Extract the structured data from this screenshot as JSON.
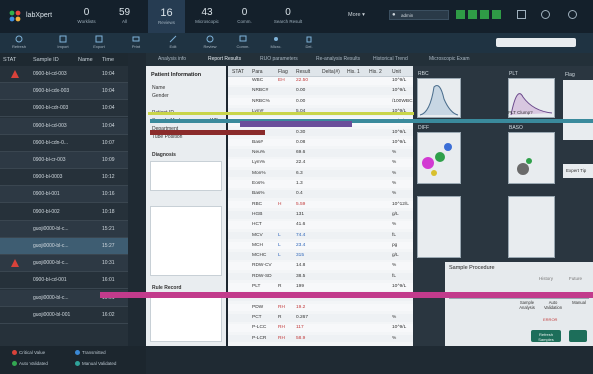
{
  "app": {
    "name": "labXpert"
  },
  "header": {
    "stats": [
      {
        "value": "0",
        "label": "Worklists"
      },
      {
        "value": "59",
        "label": "All"
      },
      {
        "value": "16",
        "label": "Reviews"
      },
      {
        "value": "43",
        "label": "Microscopic"
      },
      {
        "value": "0",
        "label": "Comm."
      },
      {
        "value": "0",
        "label": "Search Result"
      }
    ],
    "more_label": "More",
    "user_label": "admin"
  },
  "toolbar": {
    "items": [
      "Refresh",
      "Import",
      "Export",
      "Print",
      "Edit",
      "Review",
      "Comm.",
      "Micro.",
      "Del."
    ]
  },
  "sample_list": {
    "columns": [
      "STAT",
      "Sample ID",
      "Name",
      "Time"
    ],
    "rows": [
      {
        "sample_id": "0900-bl-cd-003",
        "time": "10:04",
        "alert": true
      },
      {
        "sample_id": "0900-bl-cdx-003",
        "time": "10:04",
        "alert": false
      },
      {
        "sample_id": "0900-bl-cdr-003",
        "time": "10:04",
        "alert": false
      },
      {
        "sample_id": "0900-bl-cd-003",
        "time": "10:04",
        "alert": false
      },
      {
        "sample_id": "0900-bl-cdn-0...",
        "time": "10:07",
        "alert": false
      },
      {
        "sample_id": "0900-bl-cr-003",
        "time": "10:09",
        "alert": false
      },
      {
        "sample_id": "0900-bl-0003",
        "time": "10:12",
        "alert": false
      },
      {
        "sample_id": "0900-bl-001",
        "time": "10:16",
        "alert": false
      },
      {
        "sample_id": "0900-bl-002",
        "time": "10:18",
        "alert": false
      },
      {
        "sample_id": "guoji0000-bl-c...",
        "time": "15:21",
        "alert": false
      },
      {
        "sample_id": "guoji0000-bl-c...",
        "time": "15:27",
        "alert": false
      },
      {
        "sample_id": "guoji0000-bl-c...",
        "time": "10:31",
        "alert": true
      },
      {
        "sample_id": "0900-bl-cd-001",
        "time": "16:01",
        "alert": false
      },
      {
        "sample_id": "guoji0000-bl-c...",
        "time": "10:01",
        "alert": false
      },
      {
        "sample_id": "guoji0000-bl-001",
        "time": "16:02",
        "alert": false
      }
    ]
  },
  "legend": {
    "critical": "Critical Value",
    "auto_validated": "Auto Validated",
    "transmitted": "Transmitted",
    "manual_validated": "Manual Validated"
  },
  "tabs": [
    "Analysis info",
    "Report Results",
    "RUO parameters",
    "Re-analysis Results",
    "Historical Trend",
    "Microscopic Exam"
  ],
  "patient_info": {
    "title": "Patient Information",
    "fields": [
      "Name",
      "Gender",
      "Patient ID",
      "Sample Mode",
      "Department",
      "Tube Position"
    ],
    "sample_mode_value": "WB",
    "diagnosis_label": "Diagnosis",
    "rule_record_label": "Rule Record"
  },
  "results": {
    "columns": [
      "STAT",
      "Para",
      "Flag",
      "Result",
      "Delta(#)",
      "His. 1",
      "His. 2",
      "Unit"
    ],
    "rows": [
      {
        "para": "WBC",
        "flag": "EH",
        "result": "22.50",
        "unit": "10^9/L"
      },
      {
        "para": "NRBC#",
        "flag": "",
        "result": "0.00",
        "unit": "10^9/L"
      },
      {
        "para": "NRBC%",
        "flag": "",
        "result": "0.00",
        "unit": "/100WBC"
      },
      {
        "para": "Lym#",
        "flag": "",
        "result": "5.04",
        "unit": "10^9/L"
      },
      {
        "para": "Mon#",
        "flag": "",
        "result": "1.06",
        "unit": "10^9/L"
      },
      {
        "para": "Eos#",
        "flag": "",
        "result": "0.30",
        "unit": "10^9/L"
      },
      {
        "para": "Bas#",
        "flag": "",
        "result": "0.08",
        "unit": "10^9/L"
      },
      {
        "para": "Neu%",
        "flag": "",
        "result": "69.6",
        "unit": "%"
      },
      {
        "para": "Lym%",
        "flag": "",
        "result": "22.4",
        "unit": "%"
      },
      {
        "para": "Mon%",
        "flag": "",
        "result": "6.3",
        "unit": "%"
      },
      {
        "para": "Eos%",
        "flag": "",
        "result": "1.3",
        "unit": "%"
      },
      {
        "para": "Bas%",
        "flag": "",
        "result": "0.4",
        "unit": "%"
      },
      {
        "para": "RBC",
        "flag": "H",
        "result": "5.59",
        "unit": "10^12/L"
      },
      {
        "para": "HGB",
        "flag": "",
        "result": "131",
        "unit": "g/L"
      },
      {
        "para": "HCT",
        "flag": "",
        "result": "41.6",
        "unit": "%"
      },
      {
        "para": "MCV",
        "flag": "L",
        "result": "74.4",
        "unit": "fL"
      },
      {
        "para": "MCH",
        "flag": "L",
        "result": "23.4",
        "unit": "pg"
      },
      {
        "para": "MCHC",
        "flag": "L",
        "result": "315",
        "unit": "g/L"
      },
      {
        "para": "RDW-CV",
        "flag": "",
        "result": "14.8",
        "unit": "%"
      },
      {
        "para": "RDW-SD",
        "flag": "",
        "result": "38.5",
        "unit": "fL"
      },
      {
        "para": "PLT",
        "flag": "R",
        "result": "199",
        "unit": "10^9/L"
      },
      {
        "para": "MPV",
        "flag": "RH",
        "result": "13.4",
        "unit": "fL"
      },
      {
        "para": "PDW",
        "flag": "RH",
        "result": "19.2",
        "unit": ""
      },
      {
        "para": "PCT",
        "flag": "R",
        "result": "0.267",
        "unit": "%"
      },
      {
        "para": "P-LCC",
        "flag": "RH",
        "result": "117",
        "unit": "10^9/L"
      },
      {
        "para": "P-LCR",
        "flag": "RH",
        "result": "58.9",
        "unit": "%"
      }
    ]
  },
  "graphs": {
    "rbc": "RBC",
    "plt": "PLT",
    "diff": "DIFF",
    "baso": "BASO",
    "flag": "Flag",
    "plt_clump": "PLT Clump?"
  },
  "expert_tip": "Expert Tip",
  "sample_procedure": {
    "title": "Sample Procedure",
    "history": "History",
    "future": "Future",
    "steps": [
      "Sample Analysis",
      "Auto Validation",
      "Manual"
    ],
    "step_code": "ERROR",
    "refresh_label": "Refresh Samples"
  }
}
